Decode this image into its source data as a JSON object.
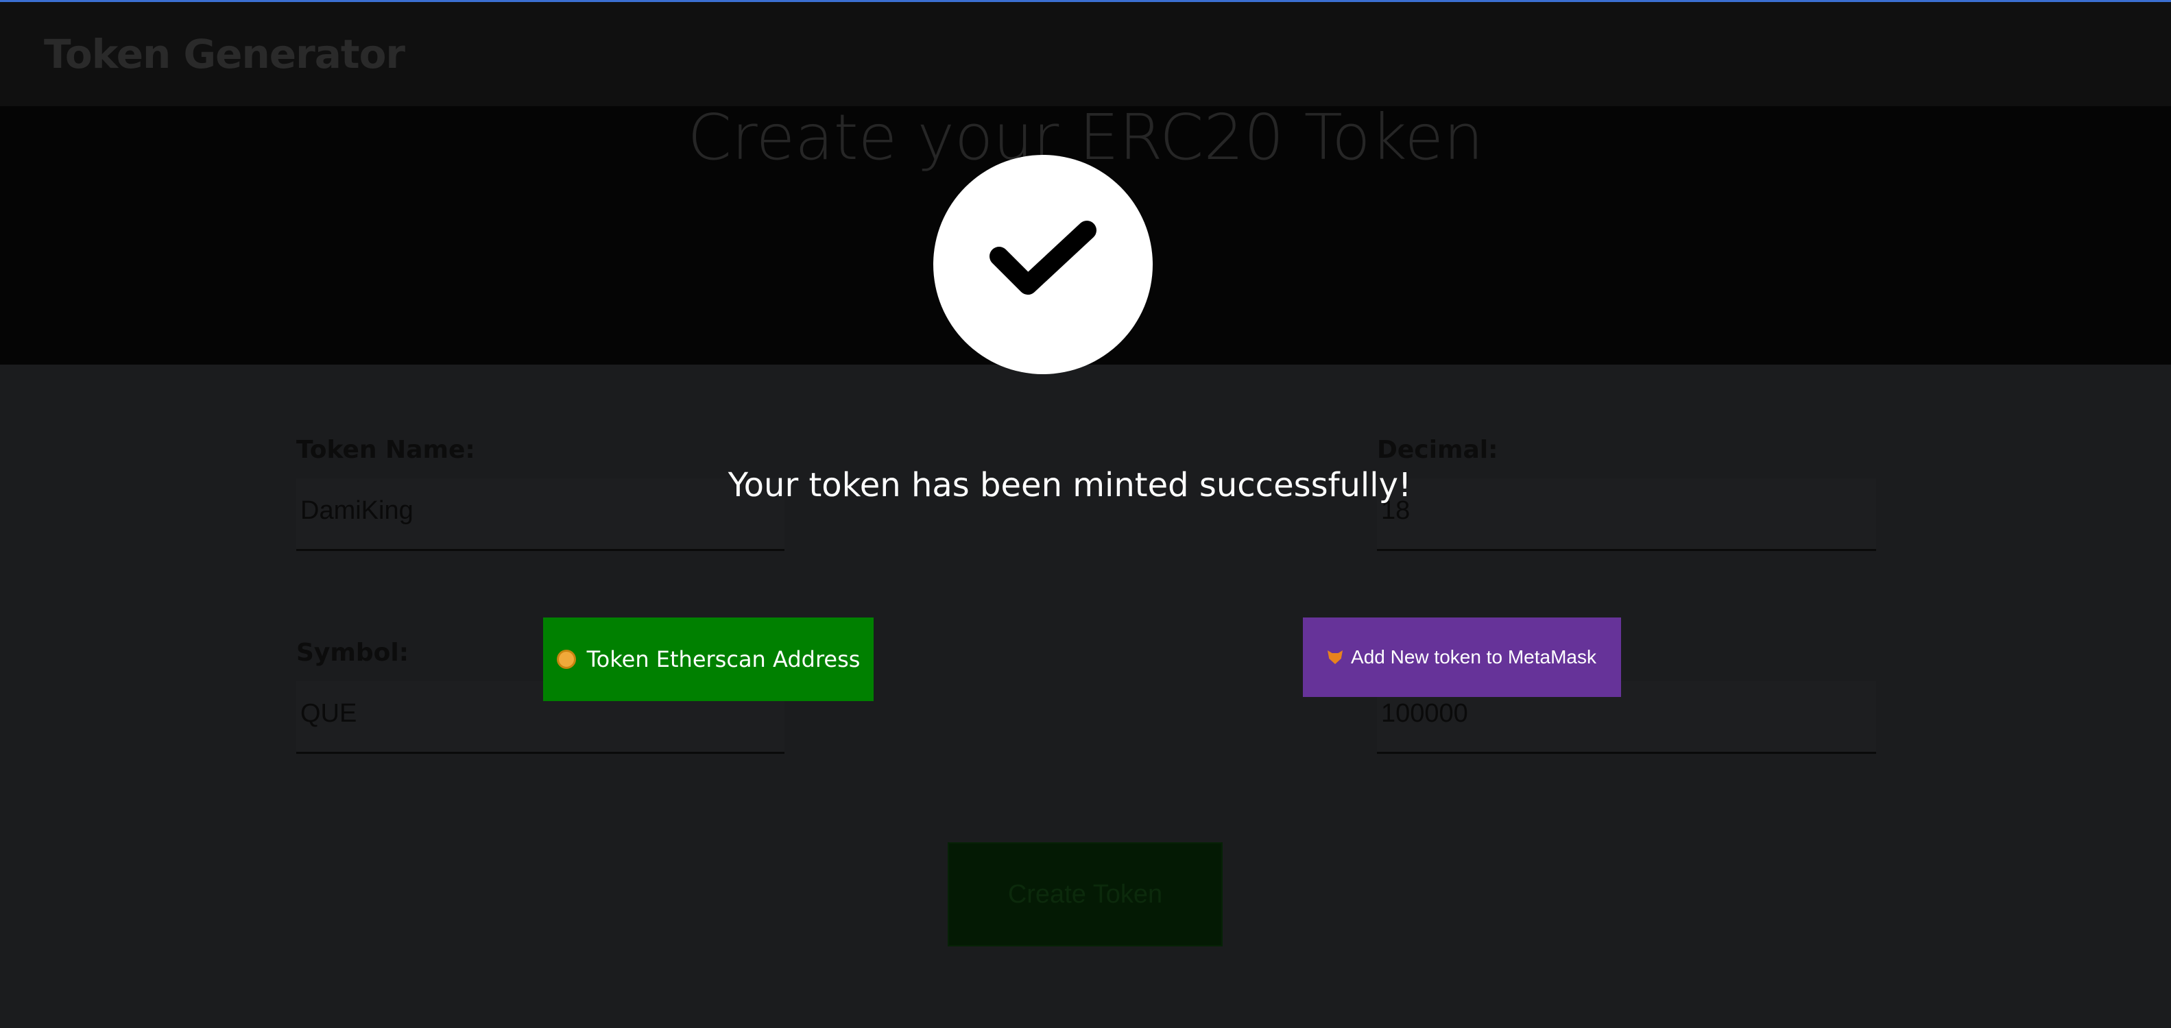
{
  "navbar": {
    "brand": "Token Generator"
  },
  "hero": {
    "title": "Create your ERC20 Token"
  },
  "form": {
    "token_name_label": "Token Name:",
    "token_name_value": "DamiKing",
    "decimal_label": "Decimal:",
    "decimal_value": "18",
    "symbol_label": "Symbol:",
    "symbol_value": "QUE",
    "supply_value": "100000",
    "create_button": "Create Token"
  },
  "modal": {
    "icon": "checkmark-icon",
    "message": "Your token has been minted successfully!",
    "etherscan_button": "Token Etherscan Address",
    "metamask_button": "Add New token to MetaMask"
  },
  "colors": {
    "etherscan_button": "#008000",
    "metamask_button": "#663399",
    "accent_line": "#3b6fd1"
  }
}
